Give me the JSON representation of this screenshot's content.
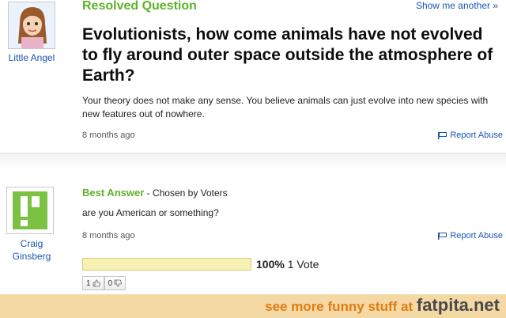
{
  "question": {
    "status_label": "Resolved Question",
    "show_another": "Show me another »",
    "asker_name": "Little Angel",
    "title": "Evolutionists, how come animals have not evolved to fly around outer space outside the atmosphere of Earth?",
    "body": "Your theory does not make any sense. You believe animals can just evolve into new species with new features out of nowhere.",
    "time_ago": "8 months ago",
    "report_label": "Report Abuse"
  },
  "answer": {
    "label": "Best Answer",
    "chosen_by": " - Chosen by Voters",
    "answerer_name": "Craig Ginsberg",
    "text": "are you American or something?",
    "time_ago": "8 months ago",
    "report_label": "Report Abuse",
    "vote_percent_label": "100%",
    "vote_count_label": " 1 Vote",
    "vote_share": 1.0,
    "thumbs_up_count": "1",
    "thumbs_down_count": "0"
  },
  "footer": {
    "prefix": "see more funny stuff at ",
    "brand": "fatpita.net"
  },
  "colors": {
    "accent_green": "#5fb12a",
    "link_blue": "#1a55b4",
    "footer_bg": "#f5d9a5",
    "footer_orange": "#e07b12"
  }
}
